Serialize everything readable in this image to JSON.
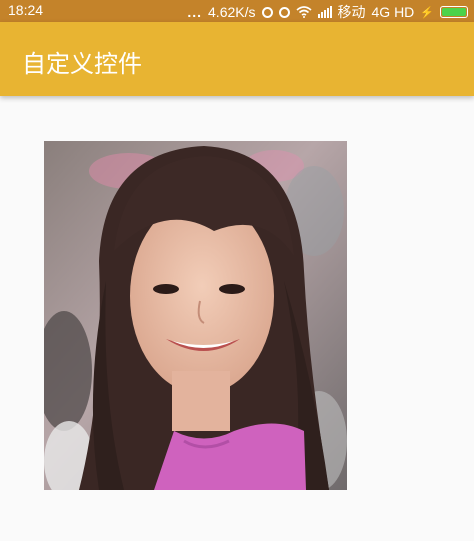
{
  "status_bar": {
    "time": "18:24",
    "dots": "...",
    "speed": "4.62K/s",
    "carrier": "移动",
    "network": "4G HD",
    "charging_glyph": "⚡"
  },
  "app_bar": {
    "title": "自定义控件",
    "color": "#e8b432"
  },
  "photo": {
    "subject": "portrait of smiling woman with long dark hair in pink top",
    "icon": "photo-image"
  }
}
